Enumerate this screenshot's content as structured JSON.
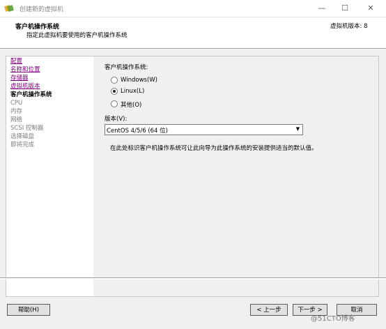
{
  "window": {
    "title": "创建新的虚拟机",
    "minimize_glyph": "—",
    "maximize_glyph": "☐",
    "close_glyph": "✕"
  },
  "header": {
    "title": "客户机操作系统",
    "subtitle": "指定此虚拟机要使用的客户机操作系统",
    "version": "虚拟机版本: 8"
  },
  "nav": {
    "items": [
      {
        "label": "配置",
        "state": "link"
      },
      {
        "label": "名称和位置",
        "state": "link"
      },
      {
        "label": "存储器",
        "state": "link"
      },
      {
        "label": "虚拟机版本",
        "state": "link"
      },
      {
        "label": "客户机操作系统",
        "state": "current"
      },
      {
        "label": "CPU",
        "state": "disabled"
      },
      {
        "label": "内存",
        "state": "disabled"
      },
      {
        "label": "网络",
        "state": "disabled"
      },
      {
        "label": "SCSI 控制器",
        "state": "disabled"
      },
      {
        "label": "选择磁盘",
        "state": "disabled"
      },
      {
        "label": "即将完成",
        "state": "disabled"
      }
    ]
  },
  "form": {
    "os_label": "客户机操作系统:",
    "options": [
      {
        "label": "Windows(W)",
        "selected": false
      },
      {
        "label": "Linux(L)",
        "selected": true
      },
      {
        "label": "其他(O)",
        "selected": false
      }
    ],
    "version_label": "版本(V):",
    "version_value": "CentOS 4/5/6 (64 位)",
    "hint": "在此处标识客户机操作系统可让此向导为此操作系统的安装提供适当的默认值。"
  },
  "buttons": {
    "help": "帮助(H)",
    "back": "< 上一步",
    "next": "下一步 >",
    "cancel": "取消"
  },
  "watermark": "@51CTO博客",
  "colors": {
    "link": "#800080",
    "disabled": "#7d7d7d",
    "app_icon_yellow": "#e8b02a",
    "app_icon_green": "#5b9e3a"
  },
  "icons": {
    "app": "vmware-logo-icon",
    "dropdown": "chevron-down-icon"
  }
}
